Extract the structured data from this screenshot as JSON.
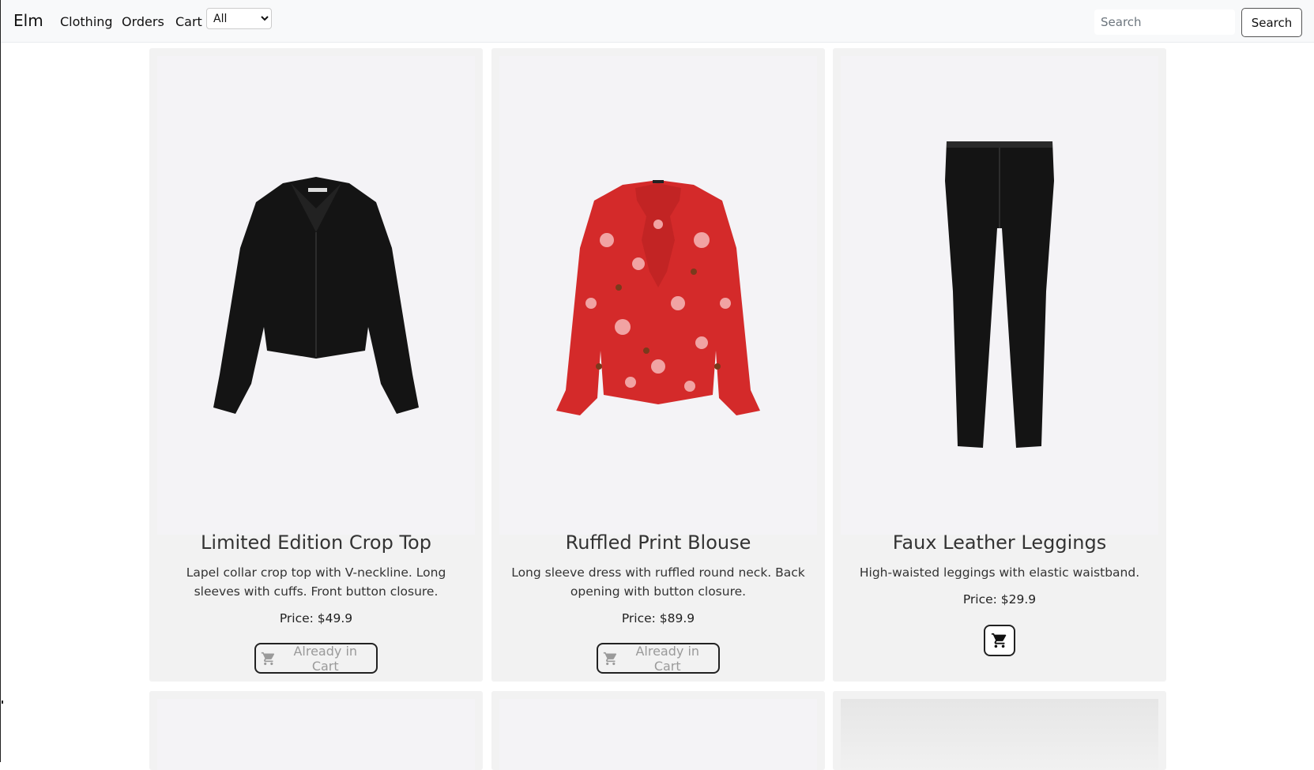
{
  "navbar": {
    "brand": "Elm",
    "links": [
      "Clothing",
      "Orders",
      "Cart"
    ],
    "category_select": {
      "selected": "All"
    },
    "search": {
      "placeholder": "Search",
      "button_label": "Search"
    }
  },
  "products": [
    {
      "title": "Limited Edition Crop Top",
      "description": "Lapel collar crop top with V-neckline. Long sleeves with cuffs. Front button closure.",
      "price": "Price: $49.9",
      "in_cart": true,
      "button_label": "Already in Cart",
      "image_icon": "black-crop-top-image"
    },
    {
      "title": "Ruffled Print Blouse",
      "description": "Long sleeve dress with ruffled round neck. Back opening with button closure.",
      "price": "Price: $89.9",
      "in_cart": true,
      "button_label": "Already in Cart",
      "image_icon": "red-floral-blouse-image"
    },
    {
      "title": "Faux Leather Leggings",
      "description": "High-waisted leggings with elastic waistband.",
      "price": "Price: $29.9",
      "in_cart": false,
      "button_label": "",
      "image_icon": "black-leggings-image"
    }
  ],
  "colors": {
    "navbar_bg": "#f8f9fa",
    "card_bg": "#f2f2f2",
    "image_bg": "#f4f3f6",
    "disabled_text": "#9a9a9a",
    "blouse_red": "#d42a2a"
  }
}
